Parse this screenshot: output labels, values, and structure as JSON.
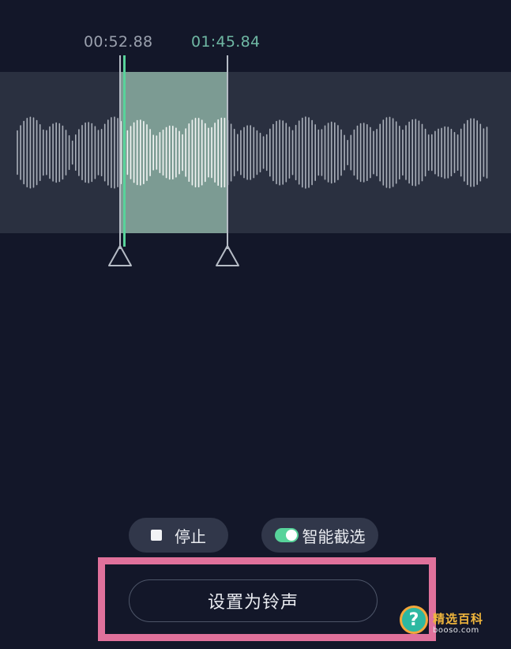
{
  "trim": {
    "start_time": "00:52.88",
    "end_time": "01:45.84"
  },
  "controls": {
    "stop_label": "停止",
    "smart_trim_label": "智能截选",
    "smart_trim_enabled": true
  },
  "primary_action": {
    "set_ringtone_label": "设置为铃声"
  },
  "watermark": {
    "icon_glyph": "?",
    "title": "精选百科",
    "subtitle": "booso.com"
  },
  "colors": {
    "background": "#131729",
    "accent_green": "#58d39a",
    "selection": "#8fb3a6",
    "highlight_pink": "#e0719b"
  },
  "icons": [
    "stop-icon",
    "toggle-switch",
    "trim-handle-triangle-icon",
    "help-icon"
  ]
}
